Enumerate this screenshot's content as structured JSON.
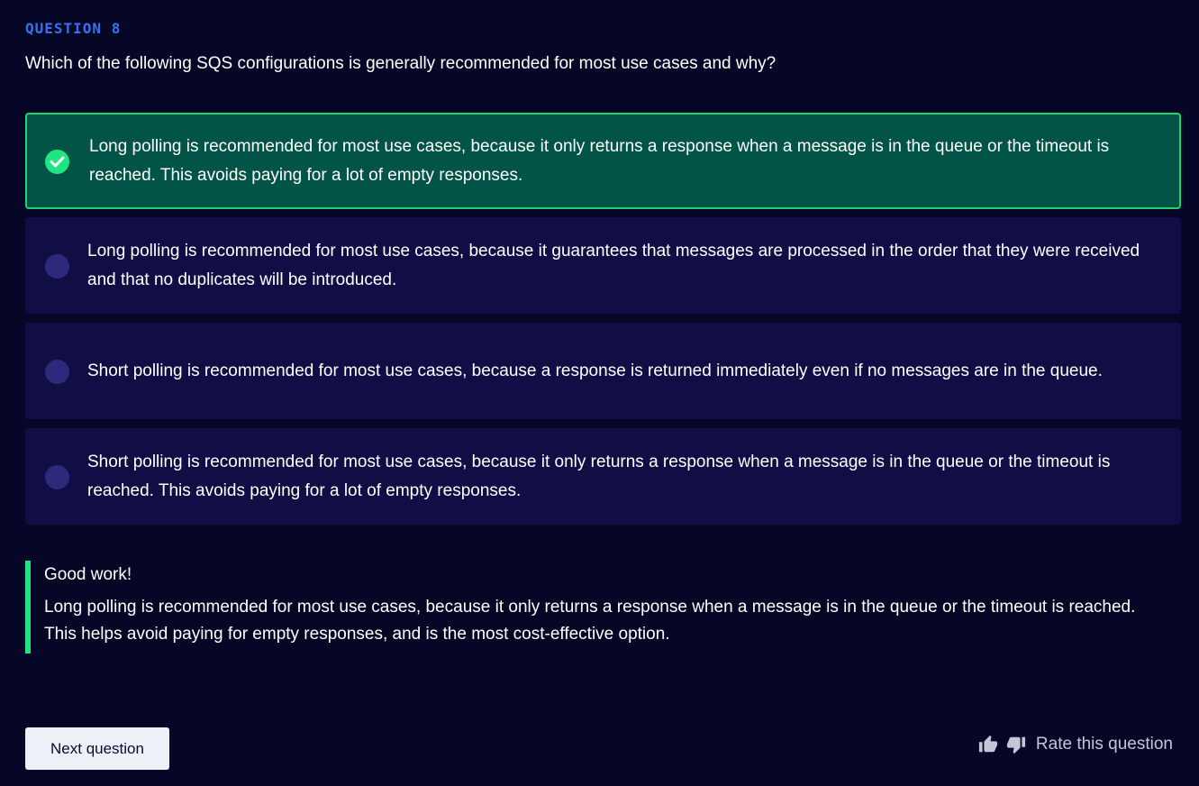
{
  "question": {
    "number_label": "QUESTION 8",
    "text": "Which of the following SQS configurations is generally recommended for most use cases and why?"
  },
  "options": [
    {
      "text": "Long polling is recommended for most use cases, because it only returns a response when a message is in the queue or the timeout is reached. This avoids paying for a lot of empty responses.",
      "selected": true
    },
    {
      "text": "Long polling is recommended for most use cases, because it guarantees that messages are processed in the order that they were received and that no duplicates will be introduced.",
      "selected": false
    },
    {
      "text": "Short polling is recommended for most use cases, because a response is returned immediately even if no messages are in the queue.",
      "selected": false
    },
    {
      "text": "Short polling is recommended for most use cases, because it only returns a response when a message is in the queue or the timeout is reached. This avoids paying for a lot of empty responses.",
      "selected": false
    }
  ],
  "feedback": {
    "title": "Good work!",
    "text": "Long polling is recommended for most use cases, because it only returns a response when a message is in the queue or the timeout is reached. This helps avoid paying for empty responses, and is the most cost-effective option."
  },
  "footer": {
    "next_label": "Next question",
    "rate_label": "Rate this question",
    "thumbs_up_icon": "thumbs-up-icon",
    "thumbs_down_icon": "thumbs-down-icon"
  },
  "colors": {
    "background": "#060726",
    "accent_blue": "#3b6ff0",
    "correct_green": "#1ee581",
    "selected_bg": "#025446",
    "option_bg": "#110e46"
  }
}
